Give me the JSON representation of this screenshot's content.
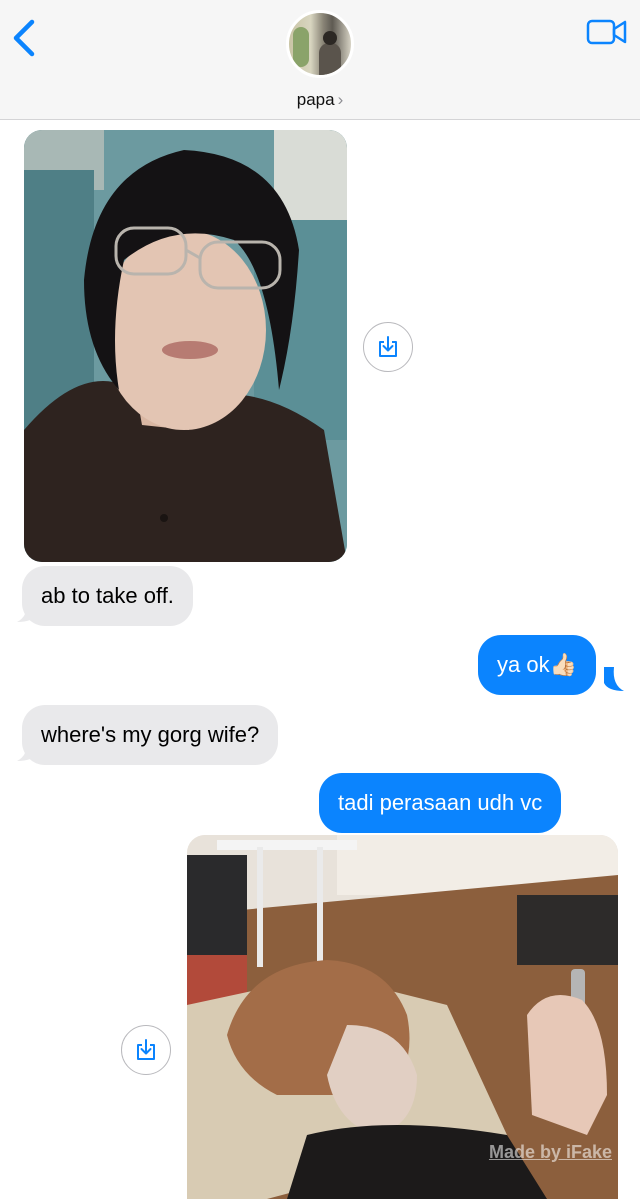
{
  "header": {
    "contact_name": "papa",
    "chevron": "›",
    "back_icon": "chevron-left-icon",
    "video_icon": "video-camera-icon",
    "accent_color": "#0b84fe"
  },
  "messages": [
    {
      "type": "photo",
      "direction": "received"
    },
    {
      "type": "text",
      "direction": "received",
      "text": "ab to take off."
    },
    {
      "type": "text",
      "direction": "sent",
      "text": "ya ok👍🏻"
    },
    {
      "type": "text",
      "direction": "received",
      "text": "where's my gorg wife?"
    },
    {
      "type": "text",
      "direction": "sent",
      "text": "tadi perasaan udh vc"
    },
    {
      "type": "photo",
      "direction": "sent"
    }
  ],
  "watermark": "Made by iFake",
  "colors": {
    "sent_bubble": "#0b84fe",
    "received_bubble": "#e9e9eb",
    "header_bg": "#f6f6f6"
  }
}
